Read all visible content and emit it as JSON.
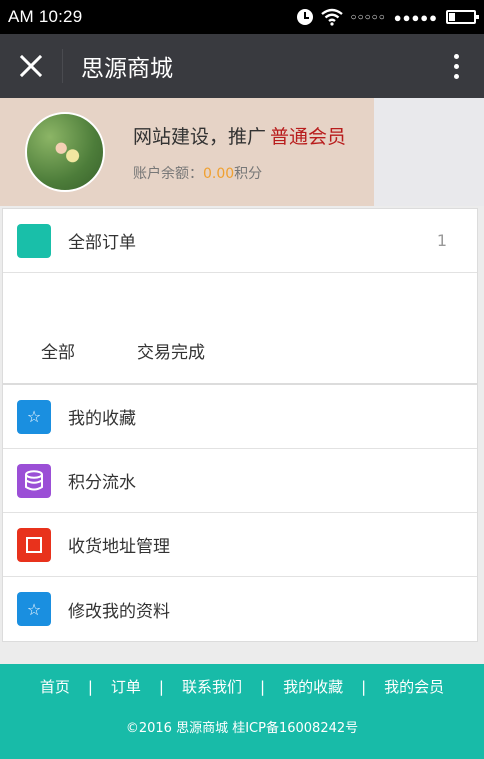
{
  "status_bar": {
    "time": "AM 10:29",
    "signal_1": "○○○○○",
    "signal_2": "●●●●●"
  },
  "header": {
    "title": "思源商城"
  },
  "profile": {
    "name": "网站建设，推广",
    "member_level": "普通会员",
    "balance_label": "账户余额：",
    "balance_value": "0.00",
    "balance_unit": "积分"
  },
  "orders": {
    "label": "全部订单",
    "count": "1",
    "tabs": [
      "全部",
      "交易完成"
    ]
  },
  "menu": [
    {
      "label": "我的收藏",
      "icon": "star-icon",
      "color": "#1a8fe0"
    },
    {
      "label": "积分流水",
      "icon": "database-icon",
      "color": "#9b4fd6"
    },
    {
      "label": "收货地址管理",
      "icon": "square-icon",
      "color": "#e8321c"
    },
    {
      "label": "修改我的资料",
      "icon": "star-icon",
      "color": "#1a8fe0"
    }
  ],
  "footer": {
    "nav": [
      "首页",
      "订单",
      "联系我们",
      "我的收藏",
      "我的会员"
    ],
    "separator": "|",
    "copyright": "©2016 思源商城 桂ICP备16008242号"
  },
  "colors": {
    "title_bar": "#393a3f",
    "orders_icon": "#19bfa9",
    "footer": "#18bba8",
    "member_badge": "#b81c1c",
    "balance_value": "#f0a030"
  }
}
